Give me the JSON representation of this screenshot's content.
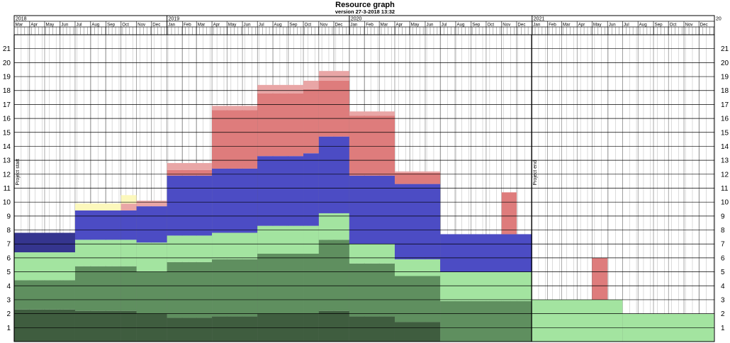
{
  "title": "Resource graph",
  "subtitle": "version 27-3-2018 13:32",
  "chart_data": {
    "type": "area",
    "x_axis": {
      "start": "2018-03-01",
      "end": "2022-01-01",
      "year_labels": [
        {
          "date": "2018-03-01",
          "label": "2018"
        },
        {
          "date": "2019-01-01",
          "label": "2019"
        },
        {
          "date": "2020-01-01",
          "label": "2020"
        },
        {
          "date": "2021-01-01",
          "label": "2021"
        },
        {
          "date": "2022-01-01",
          "label": "20"
        }
      ],
      "month_labels": [
        "Jan",
        "Feb",
        "Mar",
        "Apr",
        "May",
        "Jun",
        "Jul",
        "Aug",
        "Sep",
        "Oct",
        "Nov",
        "Dec"
      ]
    },
    "y_axis": {
      "min": 0,
      "max": 22,
      "ticks": [
        1,
        2,
        3,
        4,
        5,
        6,
        7,
        8,
        9,
        10,
        11,
        12,
        13,
        14,
        15,
        16,
        17,
        18,
        19,
        20,
        21
      ]
    },
    "grid": true,
    "markers": [
      {
        "date": "2018-03-01",
        "label": "Project start"
      },
      {
        "date": "2020-12-31",
        "label": "Project end"
      }
    ],
    "colors": {
      "dark_green": "#3f5d3f",
      "mid_green": "#5f8f5f",
      "light_green": "#a3e4a0",
      "blue": "#4c4cc4",
      "dark_blue": "#35358f",
      "red": "#de7c7c",
      "pink": "#e9a6a6",
      "yellow": "#fcf8bc"
    },
    "segments": [
      {
        "start": "2018-03-01",
        "end": "2018-07-01",
        "stack": [
          {
            "color": "dark_green",
            "value": 2.3
          },
          {
            "color": "mid_green",
            "value": 2.1
          },
          {
            "color": "light_green",
            "value": 2.0
          },
          {
            "color": "dark_blue",
            "value": 1.4
          }
        ]
      },
      {
        "start": "2018-07-01",
        "end": "2018-10-01",
        "stack": [
          {
            "color": "dark_green",
            "value": 2.2
          },
          {
            "color": "mid_green",
            "value": 3.2
          },
          {
            "color": "light_green",
            "value": 1.9
          },
          {
            "color": "blue",
            "value": 2.1
          },
          {
            "color": "yellow",
            "value": 0.5
          }
        ]
      },
      {
        "start": "2018-10-01",
        "end": "2018-11-01",
        "stack": [
          {
            "color": "dark_green",
            "value": 2.2
          },
          {
            "color": "mid_green",
            "value": 3.2
          },
          {
            "color": "light_green",
            "value": 1.9
          },
          {
            "color": "blue",
            "value": 2.1
          },
          {
            "color": "pink",
            "value": 0.5
          },
          {
            "color": "yellow",
            "value": 0.6
          }
        ]
      },
      {
        "start": "2018-11-01",
        "end": "2019-01-01",
        "stack": [
          {
            "color": "dark_green",
            "value": 2.0
          },
          {
            "color": "mid_green",
            "value": 3.0
          },
          {
            "color": "light_green",
            "value": 2.1
          },
          {
            "color": "blue",
            "value": 2.6
          },
          {
            "color": "pink",
            "value": 0.4
          }
        ]
      },
      {
        "start": "2019-01-01",
        "end": "2019-04-01",
        "stack": [
          {
            "color": "dark_green",
            "value": 1.7
          },
          {
            "color": "mid_green",
            "value": 4.0
          },
          {
            "color": "light_green",
            "value": 1.9
          },
          {
            "color": "blue",
            "value": 4.3
          },
          {
            "color": "red",
            "value": 0.4
          },
          {
            "color": "pink",
            "value": 0.5
          }
        ]
      },
      {
        "start": "2019-04-01",
        "end": "2019-07-01",
        "stack": [
          {
            "color": "dark_green",
            "value": 1.8
          },
          {
            "color": "mid_green",
            "value": 4.1
          },
          {
            "color": "light_green",
            "value": 1.9
          },
          {
            "color": "blue",
            "value": 4.6
          },
          {
            "color": "red",
            "value": 4.2
          },
          {
            "color": "pink",
            "value": 0.3
          }
        ]
      },
      {
        "start": "2019-07-01",
        "end": "2019-10-01",
        "stack": [
          {
            "color": "dark_green",
            "value": 2.0
          },
          {
            "color": "mid_green",
            "value": 4.3
          },
          {
            "color": "light_green",
            "value": 2.0
          },
          {
            "color": "blue",
            "value": 5.0
          },
          {
            "color": "red",
            "value": 4.5
          },
          {
            "color": "pink",
            "value": 0.6
          }
        ]
      },
      {
        "start": "2019-10-01",
        "end": "2019-11-01",
        "stack": [
          {
            "color": "dark_green",
            "value": 2.0
          },
          {
            "color": "mid_green",
            "value": 4.3
          },
          {
            "color": "light_green",
            "value": 2.0
          },
          {
            "color": "blue",
            "value": 5.2
          },
          {
            "color": "red",
            "value": 4.6
          },
          {
            "color": "pink",
            "value": 0.6
          }
        ]
      },
      {
        "start": "2019-11-01",
        "end": "2020-01-01",
        "stack": [
          {
            "color": "dark_green",
            "value": 2.2
          },
          {
            "color": "mid_green",
            "value": 5.1
          },
          {
            "color": "light_green",
            "value": 1.9
          },
          {
            "color": "blue",
            "value": 5.5
          },
          {
            "color": "red",
            "value": 4.0
          },
          {
            "color": "pink",
            "value": 0.7
          }
        ]
      },
      {
        "start": "2020-01-01",
        "end": "2020-04-01",
        "stack": [
          {
            "color": "dark_green",
            "value": 1.8
          },
          {
            "color": "mid_green",
            "value": 3.8
          },
          {
            "color": "light_green",
            "value": 1.4
          },
          {
            "color": "blue",
            "value": 4.9
          },
          {
            "color": "red",
            "value": 4.3
          },
          {
            "color": "pink",
            "value": 0.3
          }
        ]
      },
      {
        "start": "2020-04-01",
        "end": "2020-07-01",
        "stack": [
          {
            "color": "dark_green",
            "value": 1.4
          },
          {
            "color": "mid_green",
            "value": 3.3
          },
          {
            "color": "light_green",
            "value": 1.2
          },
          {
            "color": "blue",
            "value": 5.4
          },
          {
            "color": "red",
            "value": 0.8
          },
          {
            "color": "pink",
            "value": 0.1
          }
        ]
      },
      {
        "start": "2020-07-01",
        "end": "2021-01-01",
        "stack": [
          {
            "color": "mid_green",
            "value": 2.9
          },
          {
            "color": "light_green",
            "value": 2.1
          },
          {
            "color": "blue",
            "value": 2.7
          }
        ]
      },
      {
        "start": "2020-11-01",
        "end": "2020-12-01",
        "stack": [
          {
            "color": "red",
            "value": 3.0,
            "base": 7.7
          }
        ]
      },
      {
        "start": "2021-01-01",
        "end": "2021-07-01",
        "stack": [
          {
            "color": "light_green",
            "value": 3.0
          }
        ]
      },
      {
        "start": "2021-05-01",
        "end": "2021-06-01",
        "stack": [
          {
            "color": "red",
            "value": 3.0,
            "base": 3.0
          }
        ]
      },
      {
        "start": "2021-07-01",
        "end": "2021-12-31",
        "stack": [
          {
            "color": "light_green",
            "value": 2.0
          }
        ]
      }
    ]
  }
}
